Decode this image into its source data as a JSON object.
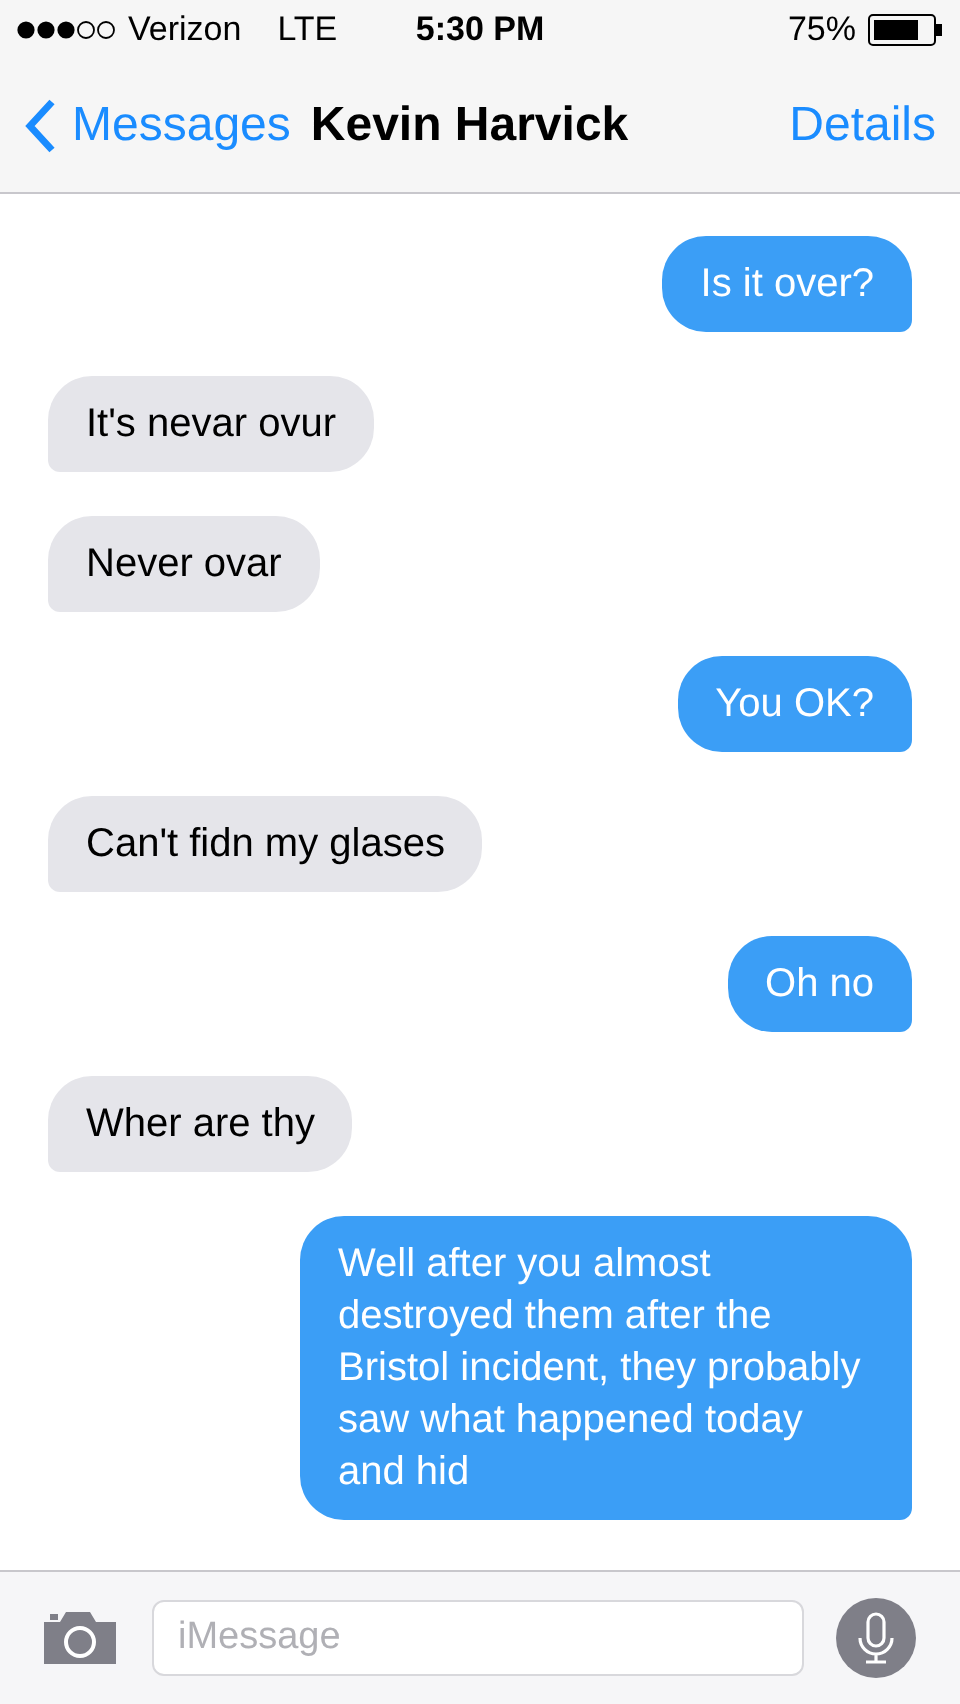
{
  "status_bar": {
    "carrier": "Verizon",
    "network": "LTE",
    "time": "5:30 PM",
    "battery": "75%"
  },
  "nav_bar": {
    "back": "Messages",
    "title": "Kevin Harvick",
    "action": "Details"
  },
  "messages": [
    {
      "kind": "sent",
      "text": "Is it over?"
    },
    {
      "kind": "received",
      "text": "It's nevar ovur"
    },
    {
      "kind": "received",
      "text": "Never ovar"
    },
    {
      "kind": "sent",
      "text": "You OK?"
    },
    {
      "kind": "received",
      "text": "Can't fidn my glases"
    },
    {
      "kind": "sent",
      "text": "Oh no"
    },
    {
      "kind": "received",
      "text": "Wher are thy"
    },
    {
      "kind": "sent",
      "text": "Well after you almost destroyed them after the Bristol incident, they probably saw what happened today and hid"
    }
  ],
  "input_bar": {
    "placeholder": "iMessage"
  }
}
